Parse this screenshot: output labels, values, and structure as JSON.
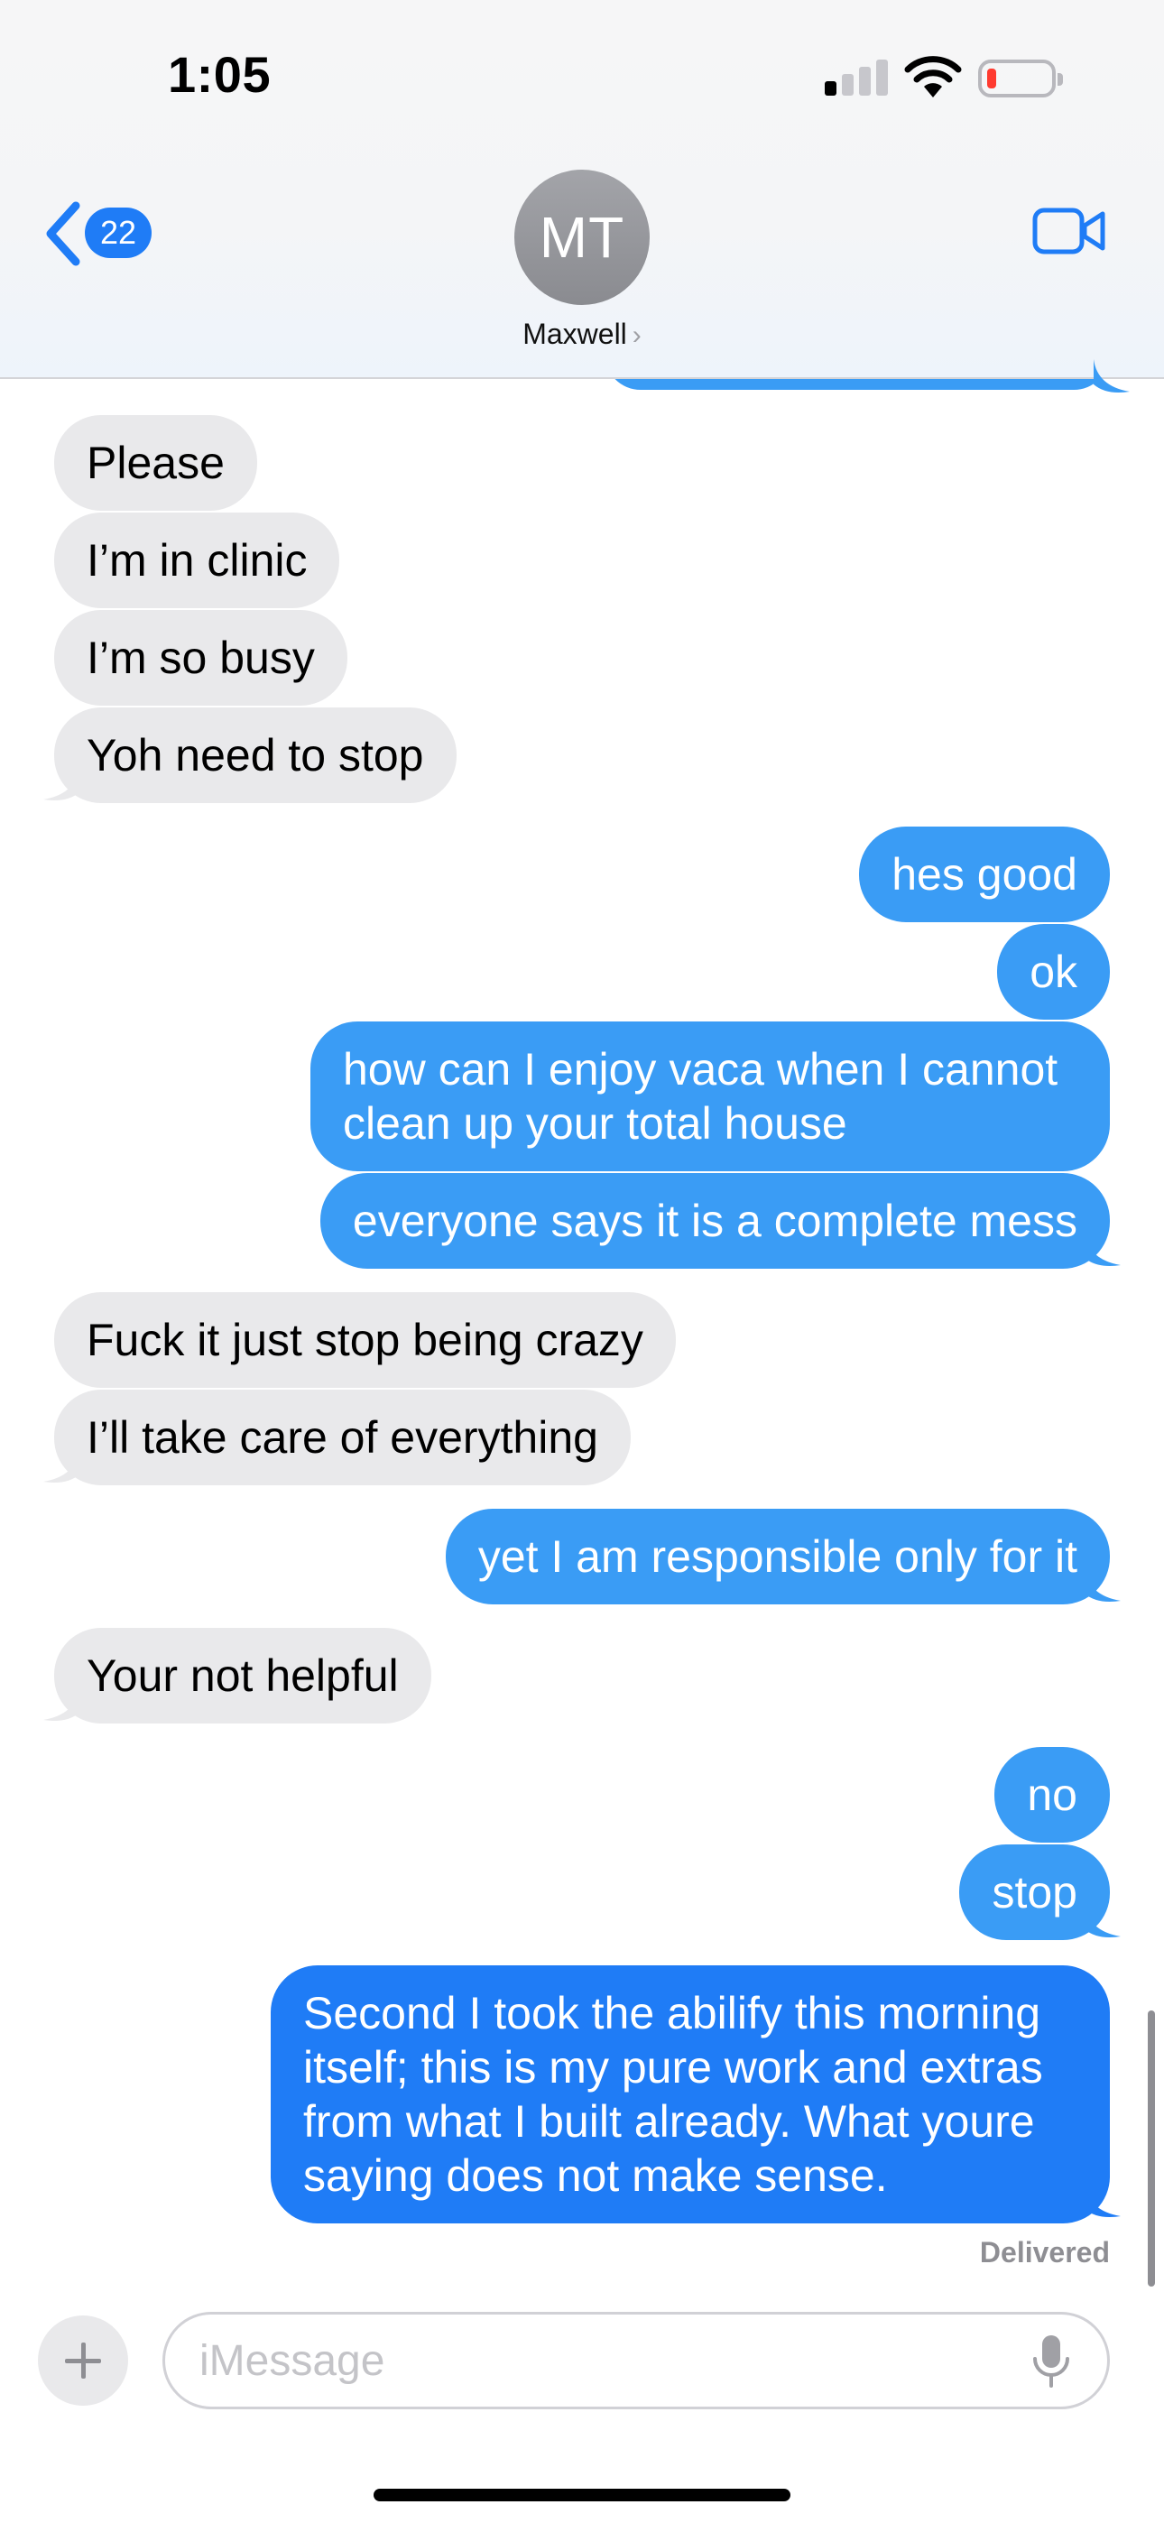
{
  "status_bar": {
    "time": "1:05",
    "signal_bars_active": 1,
    "signal_bars_total": 4,
    "battery_level_fraction": 0.1
  },
  "header": {
    "back_count": "22",
    "avatar_initials": "MT",
    "contact_name": "Maxwell",
    "contact_chevron": "›",
    "icons": {
      "back": "chevron-left-icon",
      "video": "video-camera-icon"
    },
    "accent_color": "#1f7cf6"
  },
  "messages": [
    {
      "from": "them",
      "text": "Please"
    },
    {
      "from": "them",
      "text": "I’m in clinic"
    },
    {
      "from": "them",
      "text": "I’m so busy"
    },
    {
      "from": "them",
      "text": "Yoh need to stop"
    },
    {
      "from": "me",
      "text": "hes good"
    },
    {
      "from": "me",
      "text": "ok"
    },
    {
      "from": "me",
      "text": "how can I enjoy vaca when I cannot clean up your total house"
    },
    {
      "from": "me",
      "text": "everyone says it is a complete mess"
    },
    {
      "from": "them",
      "text": "Fuck it just stop being crazy"
    },
    {
      "from": "them",
      "text": "I’ll take care of everything"
    },
    {
      "from": "me",
      "text": "yet I am responsible only for it"
    },
    {
      "from": "them",
      "text": "Your not helpful"
    },
    {
      "from": "me",
      "text": "no"
    },
    {
      "from": "me",
      "text": "stop"
    },
    {
      "from": "me",
      "text": "Second I took the abilify this morning itself; this is my pure work and extras from what I built already. What youre saying does not make sense."
    }
  ],
  "delivery_status": "Delivered",
  "composer": {
    "placeholder": "iMessage",
    "value": "",
    "icons": {
      "add": "plus-icon",
      "dictation": "microphone-icon"
    }
  },
  "colors": {
    "outgoing_bubble": "#3a9cf5",
    "outgoing_bubble_latest": "#1f7cf6",
    "incoming_bubble": "#e9e9eb"
  }
}
